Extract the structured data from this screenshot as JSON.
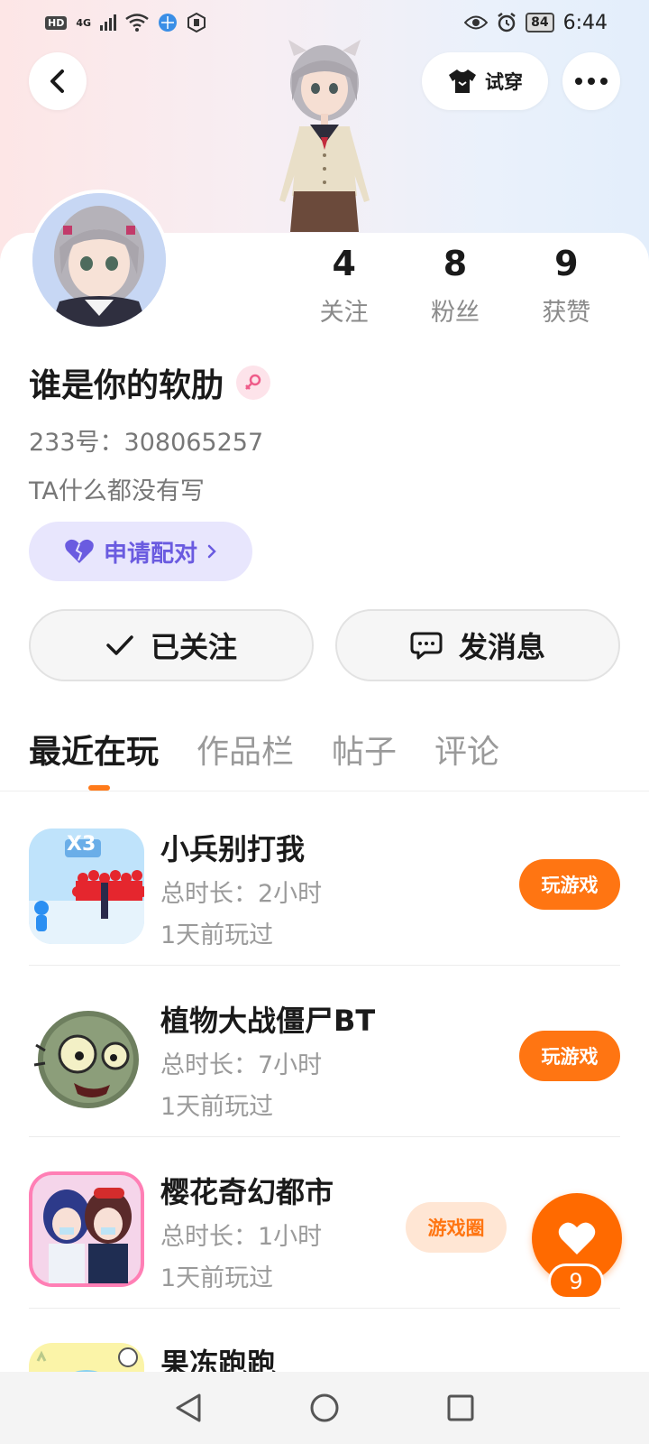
{
  "status_bar": {
    "network_badge": "HD",
    "network_type": "4G",
    "battery": "84",
    "time": "6:44"
  },
  "header": {
    "try_on_label": "试穿"
  },
  "profile": {
    "name": "谁是你的软肋",
    "id_text": "233号：308065257",
    "bio": "TA什么都没有写",
    "pair_label": "申请配对",
    "stats": [
      {
        "value": "4",
        "label": "关注"
      },
      {
        "value": "8",
        "label": "粉丝"
      },
      {
        "value": "9",
        "label": "获赞"
      }
    ],
    "follow_label": "已关注",
    "message_label": "发消息"
  },
  "tabs": [
    {
      "label": "最近在玩",
      "active": true
    },
    {
      "label": "作品栏",
      "active": false
    },
    {
      "label": "帖子",
      "active": false
    },
    {
      "label": "评论",
      "active": false
    }
  ],
  "games": [
    {
      "name": "小兵别打我",
      "time": "总时长：2小时",
      "last_played": "1天前玩过",
      "play_label": "玩游戏",
      "icon_text": "X3"
    },
    {
      "name": "植物大战僵尸BT",
      "time": "总时长：7小时",
      "last_played": "1天前玩过",
      "play_label": "玩游戏"
    },
    {
      "name": "樱花奇幻都市",
      "time": "总时长：1小时",
      "last_played": "1天前玩过",
      "circle_label": "游戏圈"
    },
    {
      "name": "果冻跑跑"
    }
  ],
  "floating_like": {
    "count": "9"
  },
  "colors": {
    "accent": "#ff7512",
    "pair_text": "#6a5be0",
    "pair_bg": "#e8e6fd"
  }
}
